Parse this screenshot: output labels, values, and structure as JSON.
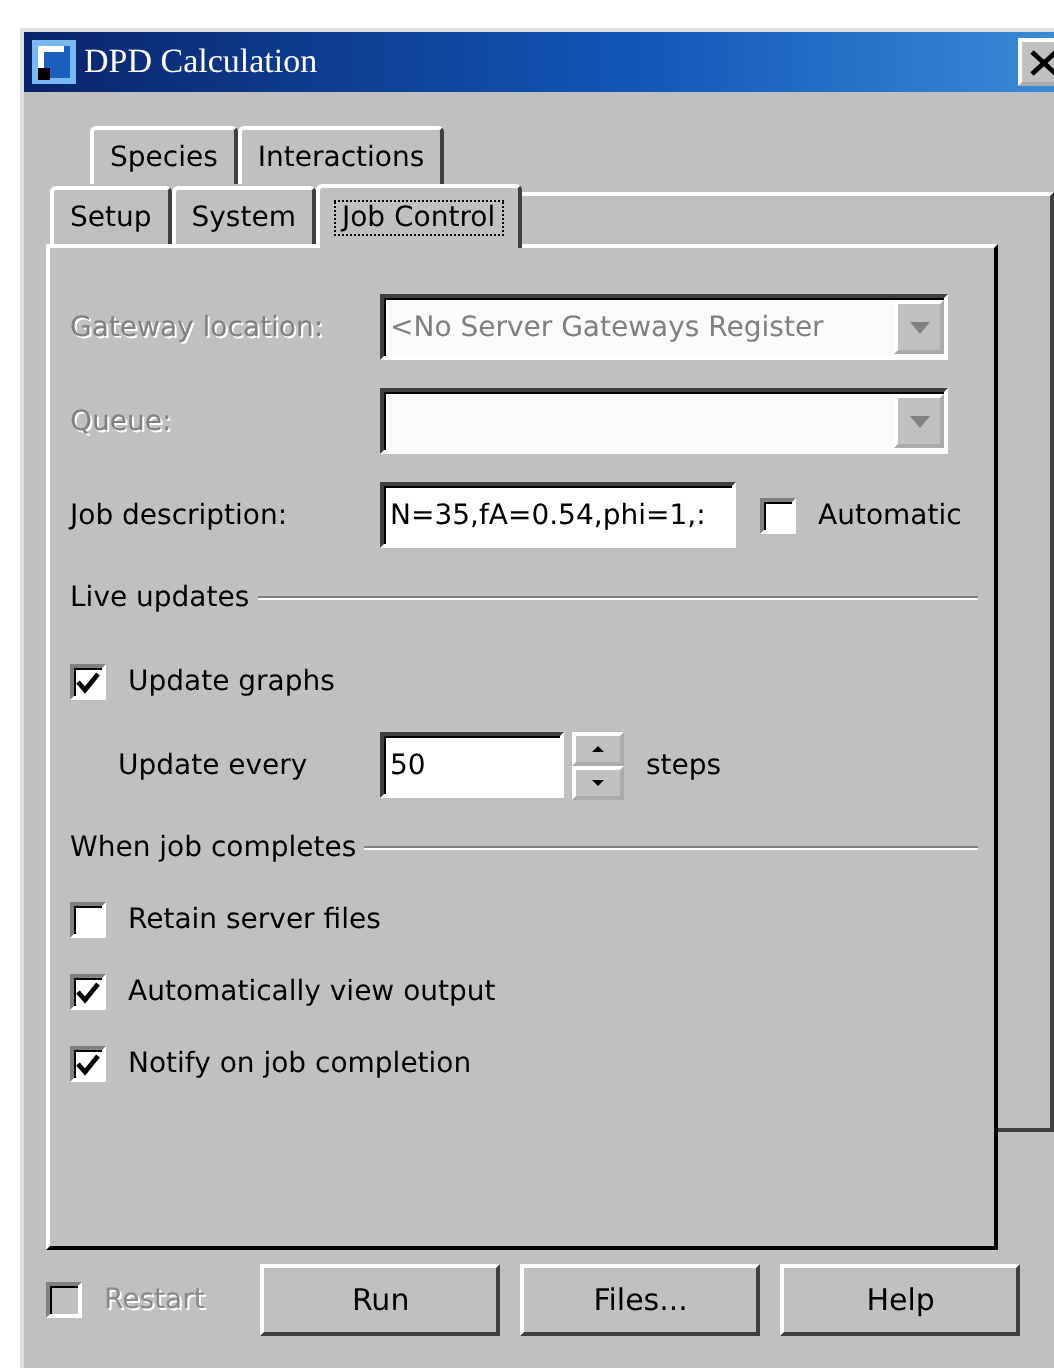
{
  "window": {
    "title": "DPD Calculation"
  },
  "tab_rows": [
    {
      "tabs": [
        {
          "label": "Species",
          "selected": false
        },
        {
          "label": "Interactions",
          "selected": false
        }
      ]
    },
    {
      "tabs": [
        {
          "label": "Setup",
          "selected": false
        },
        {
          "label": "System",
          "selected": false
        },
        {
          "label": "Job Control",
          "selected": true
        }
      ]
    }
  ],
  "fields": [
    {
      "kind": "dropdown",
      "label": "Gateway location:",
      "value": "<No Server Gateways Register",
      "disabled": true
    },
    {
      "kind": "dropdown",
      "label": "Queue:",
      "disabled": true
    },
    {
      "kind": "text",
      "label": "Job description:",
      "value": "N=35,fA=0.54,phi=1,:",
      "disabled": false,
      "option": {
        "label": "Automatic",
        "checked": false
      }
    }
  ],
  "live_updates": {
    "title": "Live updates",
    "update_graphs": {
      "label": "Update graphs",
      "checked": true
    },
    "update_every": {
      "label": "Update every",
      "value": "50",
      "unit": "steps"
    }
  },
  "when_job_completes": {
    "title": "When job completes",
    "options": [
      {
        "label": "Retain server files",
        "checked": false
      },
      {
        "label": "Automatically view output",
        "checked": true
      },
      {
        "label": "Notify on job completion",
        "checked": true
      }
    ]
  },
  "footer": {
    "restart": {
      "label": "Restart",
      "checked": false,
      "disabled": true
    },
    "buttons": [
      "Run",
      "Files...",
      "Help"
    ]
  }
}
